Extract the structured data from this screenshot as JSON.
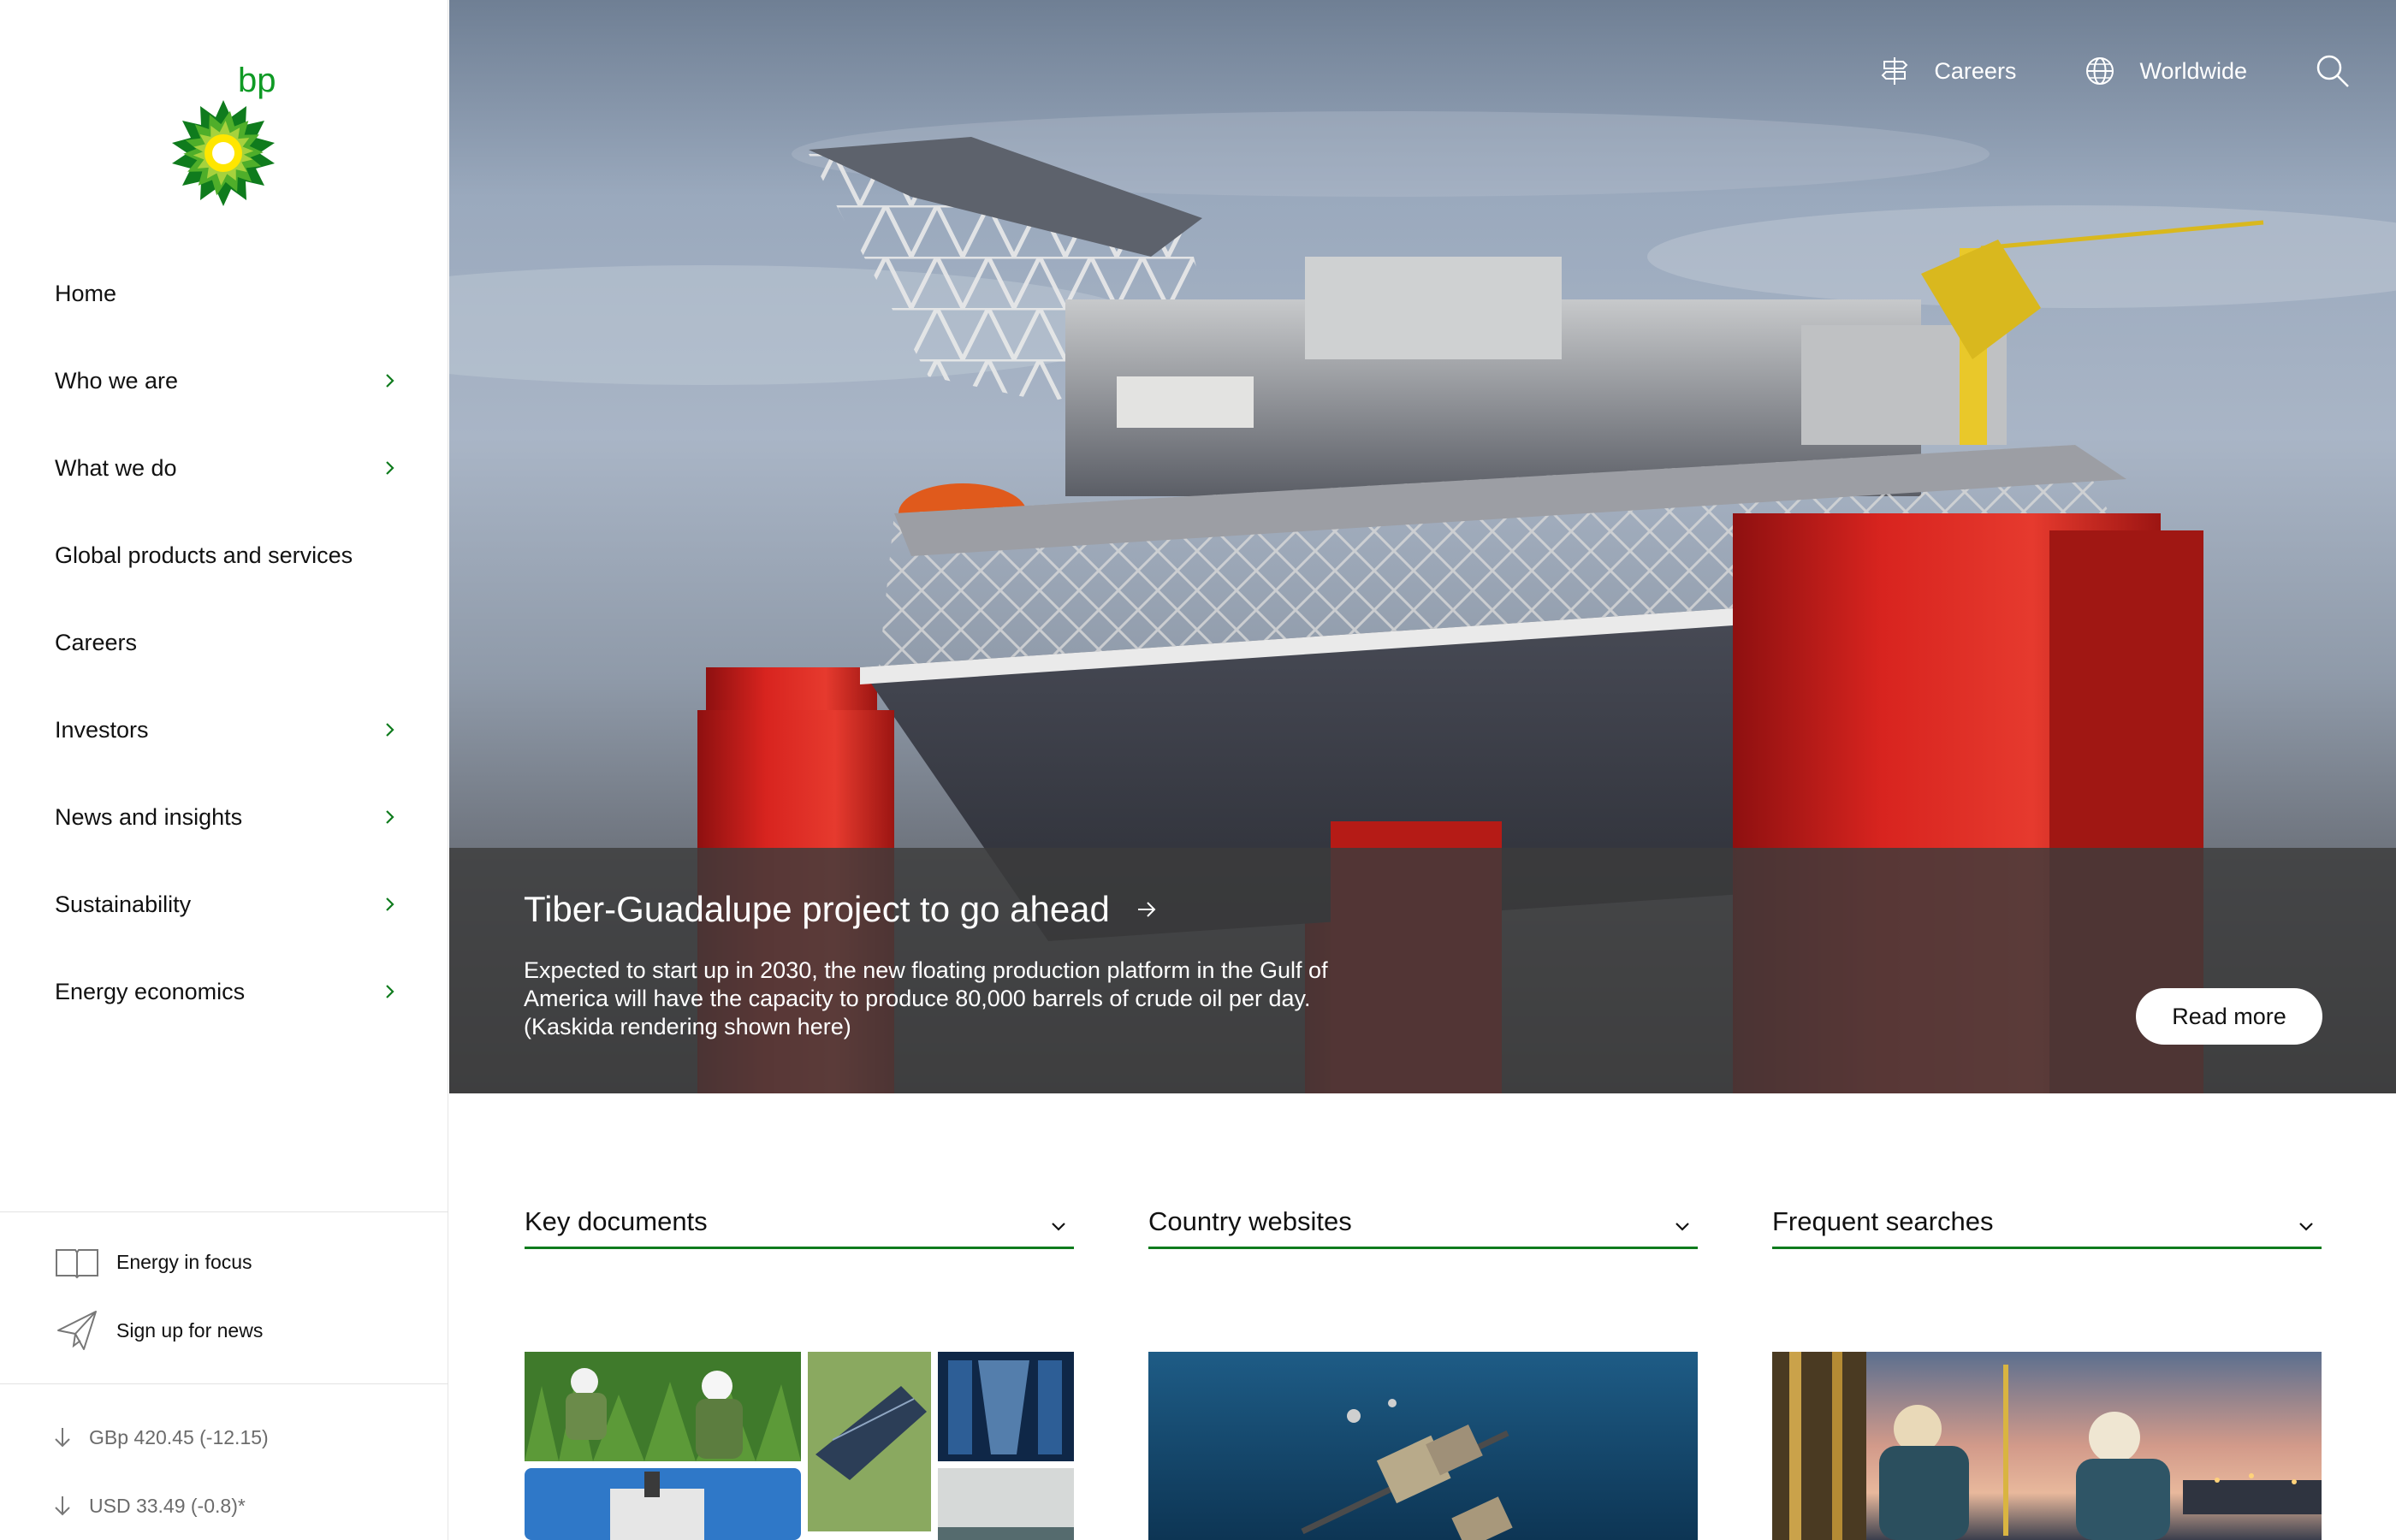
{
  "brand": {
    "logo_text": "bp",
    "colors": {
      "green": "#0f7b1d",
      "yellow": "#ffe600",
      "light_green": "#8dc63f"
    }
  },
  "sidebar": {
    "nav": [
      {
        "label": "Home",
        "has_submenu": false
      },
      {
        "label": "Who we are",
        "has_submenu": true
      },
      {
        "label": "What we do",
        "has_submenu": true
      },
      {
        "label": "Global products and services",
        "has_submenu": false
      },
      {
        "label": "Careers",
        "has_submenu": false
      },
      {
        "label": "Investors",
        "has_submenu": true
      },
      {
        "label": "News and insights",
        "has_submenu": true
      },
      {
        "label": "Sustainability",
        "has_submenu": true
      },
      {
        "label": "Energy economics",
        "has_submenu": true
      }
    ],
    "utilities": [
      {
        "label": "Energy in focus",
        "icon": "book-icon"
      },
      {
        "label": "Sign up for news",
        "icon": "paper-plane-icon"
      }
    ],
    "stocks": [
      {
        "label": "GBp 420.45 (-12.15)",
        "direction": "down"
      },
      {
        "label": "USD 33.49 (-0.8)*",
        "direction": "down"
      }
    ]
  },
  "topbar": {
    "careers_label": "Careers",
    "worldwide_label": "Worldwide"
  },
  "hero": {
    "title": "Tiber-Guadalupe project to go ahead",
    "description": "Expected to start up in 2030, the new floating production platform in the Gulf of America will have the capacity to produce 80,000 barrels of crude oil per day. (Kaskida rendering shown here)",
    "cta_label": "Read more"
  },
  "dropdowns": [
    {
      "label": "Key documents"
    },
    {
      "label": "Country websites"
    },
    {
      "label": "Frequent searches"
    }
  ]
}
